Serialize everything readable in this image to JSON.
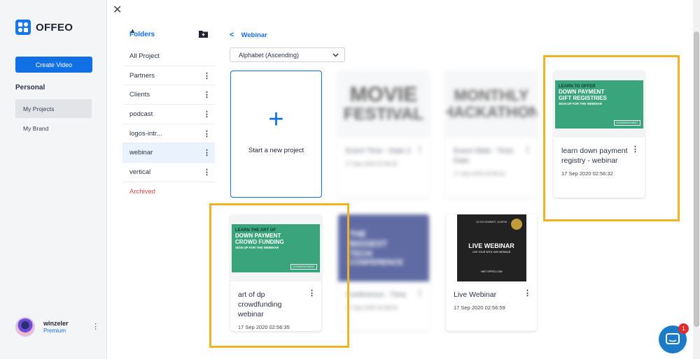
{
  "app": {
    "name": "OFFEO"
  },
  "sidebar": {
    "create_button": "Create Video",
    "section": "Personal",
    "items": [
      {
        "label": "My Projects",
        "active": true
      },
      {
        "label": "My Brand",
        "active": false
      }
    ],
    "user": {
      "name": "winzeler",
      "plan": "Premium"
    }
  },
  "modal": {
    "folders_heading": "Folders",
    "folders": [
      {
        "label": "All Project"
      },
      {
        "label": "Partners"
      },
      {
        "label": "Clients"
      },
      {
        "label": "podcast"
      },
      {
        "label": "logos-intr..."
      },
      {
        "label": "webinar",
        "active": true
      },
      {
        "label": "vertical"
      },
      {
        "label": "Archived"
      }
    ],
    "breadcrumb": "Webinar",
    "sort": {
      "selected": "Alphabet (Ascending)"
    },
    "new_project_label": "Start a new project",
    "cards": [
      {
        "thumb_text": [
          "MOVIE",
          "FESTIVAL"
        ],
        "title": "Event Time - Date 2",
        "date": "17 Sep 2020 02:56:32"
      },
      {
        "thumb_text": [
          "MONTHLY",
          "HACKATHON"
        ],
        "title": "Event Slide - Time Date",
        "date": "17 Sep 2020 02:56:32"
      },
      {
        "thumb": {
          "l1": "LEARN TO OFFER",
          "l2a": "DOWN PAYMENT",
          "l2b": "GIFT REGISTRIES",
          "l3": "SIGN UP FOR THE WEBINAR",
          "brand": "DOWNPAYMENT"
        },
        "title": "learn down payment registry - webinar",
        "date": "17 Sep 2020 02:56:32"
      },
      {
        "thumb": {
          "l1": "LEARN THE ART OF",
          "l2a": "DOWN PAYMENT",
          "l2b": "CROWD FUNDING",
          "l3": "SIGN UP FOR THE WEBINAR",
          "brand": "DOWNPAYMENT"
        },
        "title": "art of dp crowdfunding webinar",
        "date": "17 Sep 2020 02:56:35"
      },
      {
        "thumb_text": [
          "THE",
          "BIGGEST",
          "TECH",
          "CONFERENCE"
        ],
        "title": "Conference - Time",
        "date": "17 Sep 2020 02:56:55"
      },
      {
        "thumb": {
          "hdr": "10 DECEMBER, 8:00PM",
          "big": "LIVE WEBINAR",
          "sub": "LIVE YOUR WITH OUR WEBINAR",
          "url": "VISIT OFFEO.COM"
        },
        "title": "Live Webinar",
        "date": "17 Sep 2020 02:56:59"
      }
    ]
  },
  "chat": {
    "badge": "1"
  },
  "colors": {
    "accent": "#1170e4",
    "highlight": "#f0b323",
    "archived": "#e24b4b"
  }
}
